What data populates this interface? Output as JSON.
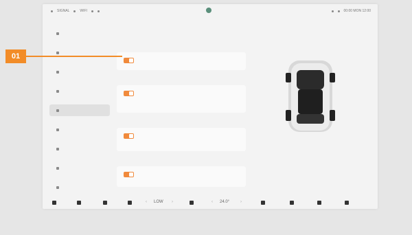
{
  "callout": {
    "number": "01"
  },
  "statusbar": {
    "left_items": [
      "SIGNAL",
      "WIFI"
    ],
    "right_text": "00:00  MON  12:00"
  },
  "tabs": [
    "",
    ""
  ],
  "sidebar": {
    "items": [
      {
        "label": "",
        "active": false
      },
      {
        "label": "",
        "active": false
      },
      {
        "label": "",
        "active": false
      },
      {
        "label": "",
        "active": false
      },
      {
        "label": "",
        "active": true
      },
      {
        "label": "",
        "active": false
      },
      {
        "label": "",
        "active": false
      },
      {
        "label": "",
        "active": false
      },
      {
        "label": "",
        "active": false
      },
      {
        "label": "",
        "active": false
      }
    ]
  },
  "settings": [
    {
      "section": "",
      "title": "",
      "desc": "",
      "enabled": true
    },
    {
      "section": "",
      "title": "",
      "desc": "",
      "enabled": true
    },
    {
      "section": "",
      "title": "",
      "desc": "",
      "enabled": true
    },
    {
      "section": "",
      "title": "",
      "desc": "",
      "enabled": true
    }
  ],
  "bottom_bar": {
    "fan_level": "LOW",
    "temperature": "24.0°"
  },
  "colors": {
    "accent": "#f08a3c",
    "callout": "#f28c28"
  }
}
